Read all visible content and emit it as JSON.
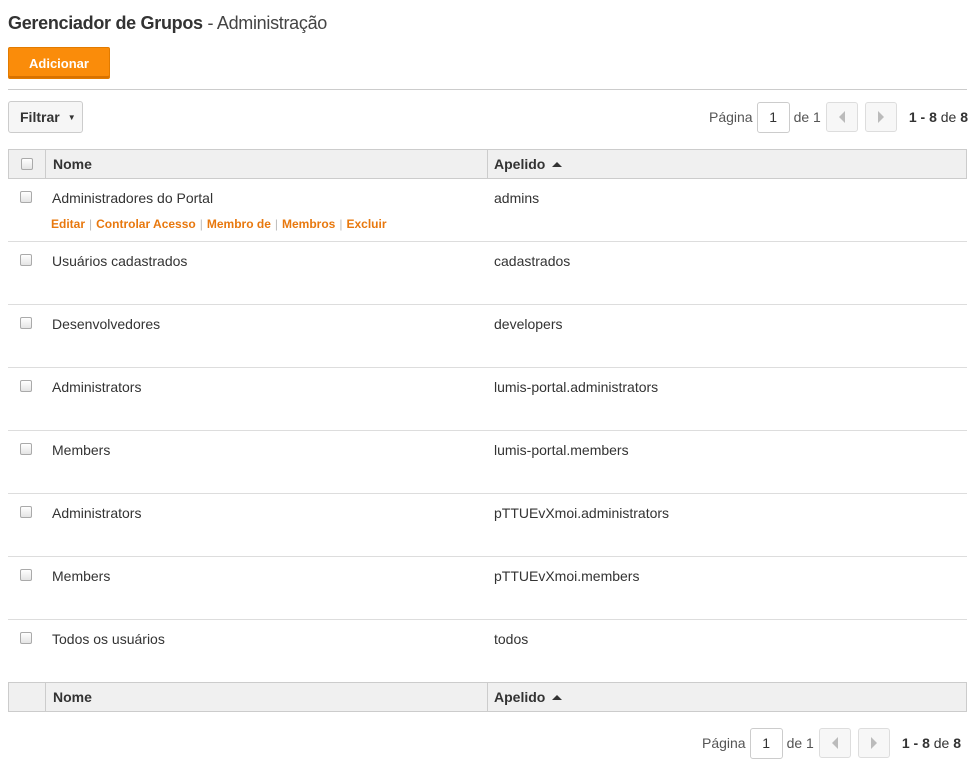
{
  "header": {
    "title": "Gerenciador de Grupos",
    "subtitle": "- Administração"
  },
  "toolbar": {
    "add_label": "Adicionar",
    "filter_label": "Filtrar"
  },
  "pager": {
    "page_label": "Página",
    "current_page": "1",
    "of_label": "de 1",
    "range": "1 - 8",
    "range_of": "de",
    "total": "8"
  },
  "table": {
    "columns": {
      "name": "Nome",
      "alias": "Apelido"
    },
    "actions": {
      "edit": "Editar",
      "access": "Controlar Acesso",
      "member_of": "Membro de",
      "members": "Membros",
      "delete": "Excluir"
    },
    "rows": [
      {
        "name": "Administradores do Portal",
        "alias": "admins"
      },
      {
        "name": "Usuários cadastrados",
        "alias": "cadastrados"
      },
      {
        "name": "Desenvolvedores",
        "alias": "developers"
      },
      {
        "name": "Administrators",
        "alias": "lumis-portal.administrators"
      },
      {
        "name": "Members",
        "alias": "lumis-portal.members"
      },
      {
        "name": "Administrators",
        "alias": "pTTUEvXmoi.administrators"
      },
      {
        "name": "Members",
        "alias": "pTTUEvXmoi.members"
      },
      {
        "name": "Todos os usuários",
        "alias": "todos"
      }
    ]
  },
  "colors": {
    "accent": "#fa8c0a",
    "link": "#e8780e"
  }
}
